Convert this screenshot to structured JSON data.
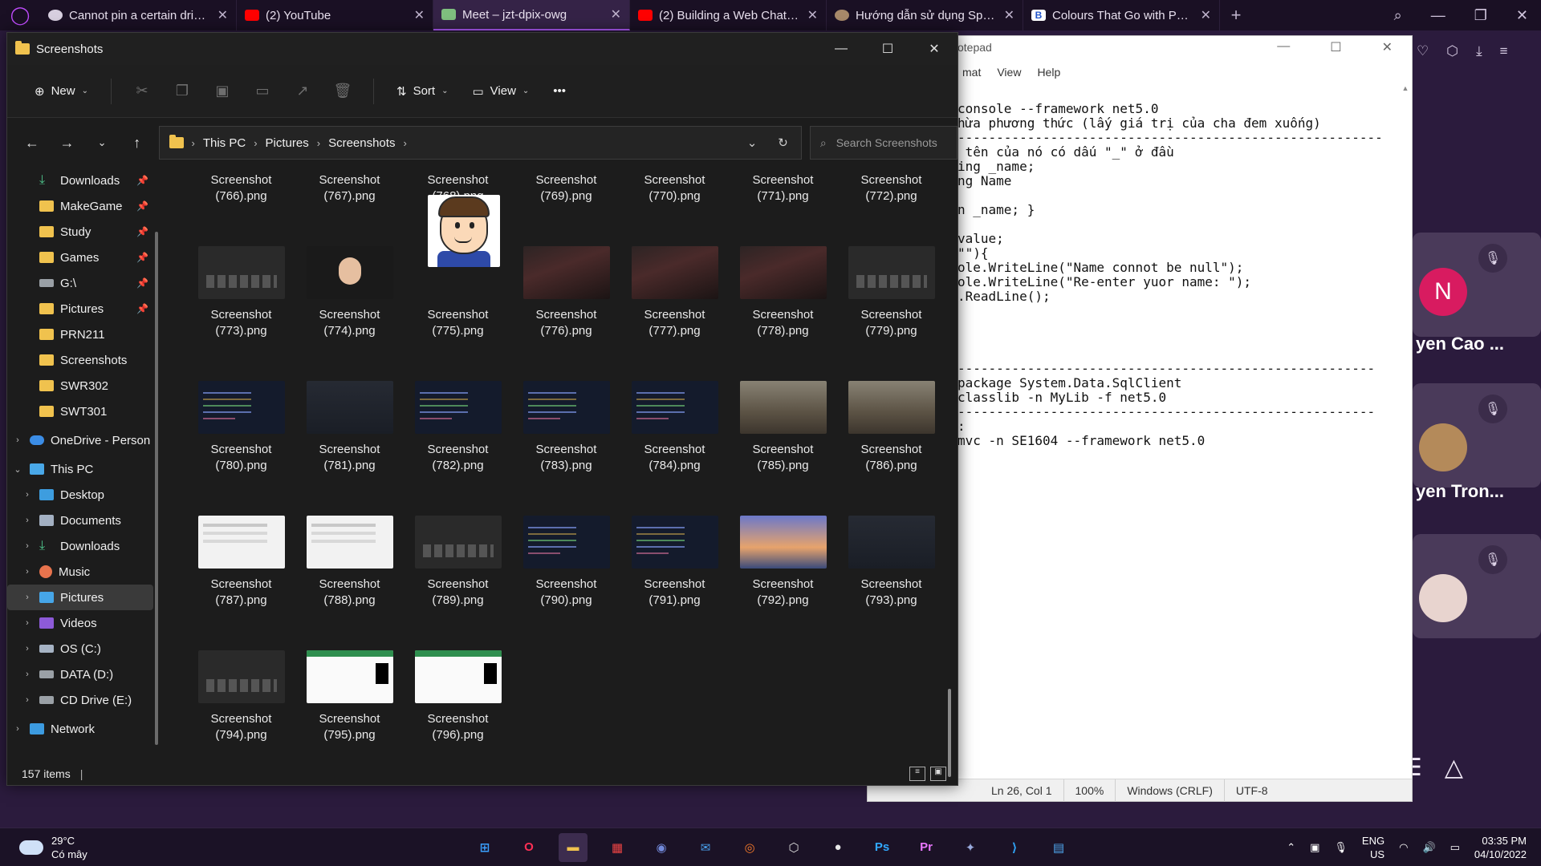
{
  "browser": {
    "tabs": [
      {
        "title": "Cannot pin a certain drive t",
        "fav": "gh",
        "active": false
      },
      {
        "title": "(2) YouTube",
        "fav": "yt",
        "active": false
      },
      {
        "title": "Meet – jzt-dpix-owg",
        "fav": "meet",
        "active": true
      },
      {
        "title": "(2) Building a Web ChatBot",
        "fav": "yt",
        "active": false
      },
      {
        "title": "Hướng dẫn sử dụng Spring",
        "fav": "spring",
        "active": false
      },
      {
        "title": "Colours That Go with Purpl",
        "fav": "blog",
        "active": false
      }
    ],
    "new_tab_glyph": "+",
    "close_glyph": "✕"
  },
  "meet": {
    "participants": [
      {
        "avatar_letter": "N",
        "avatar_color": "#d81b60",
        "name": "yen Cao ..."
      },
      {
        "avatar_letter": "",
        "avatar_color": "#b48a5a",
        "name": "yen Tron..."
      },
      {
        "avatar_letter": "",
        "avatar_color": "#e8d4cf",
        "name": ""
      }
    ]
  },
  "notepad": {
    "title": "otepad",
    "menu": [
      "mat",
      "View",
      "Help"
    ],
    "lines": [
      "console --framework net5.0",
      "hừa phương thức (lấy giá trị của cha đem xuống)",
      "-------------------------------------------------------",
      " tên của nó có dấu \"_\" ở đầu",
      "ing _name;",
      "ng Name",
      "",
      "n _name; }",
      "",
      "value;",
      "\"\"){",
      "ole.WriteLine(\"Name connot be null\");",
      "ole.WriteLine(\"Re-enter yuor name: \");",
      ".ReadLine();",
      "",
      "",
      "",
      "",
      "------------------------------------------------------",
      "package System.Data.SqlClient",
      "classlib -n MyLib -f net5.0",
      "------------------------------------------------------",
      ":",
      "mvc -n SE1604 --framework net5.0"
    ],
    "status": {
      "position": "Ln 26, Col 1",
      "zoom": "100%",
      "line_ending": "Windows (CRLF)",
      "encoding": "UTF-8"
    }
  },
  "explorer": {
    "title": "Screenshots",
    "toolbar": {
      "new_label": "New",
      "sort_label": "Sort",
      "view_label": "View",
      "more_label": "•••"
    },
    "breadcrumb": [
      "This PC",
      "Pictures",
      "Screenshots"
    ],
    "search_placeholder": "Search Screenshots",
    "sidebar": [
      {
        "label": "Downloads",
        "icon": "download",
        "pinned": true,
        "indent": 1,
        "expander": ""
      },
      {
        "label": "MakeGame",
        "icon": "folder",
        "pinned": true,
        "indent": 1,
        "expander": ""
      },
      {
        "label": "Study",
        "icon": "folder",
        "pinned": true,
        "indent": 1,
        "expander": ""
      },
      {
        "label": "Games",
        "icon": "folder",
        "pinned": true,
        "indent": 1,
        "expander": ""
      },
      {
        "label": "G:\\",
        "icon": "drive",
        "pinned": true,
        "indent": 1,
        "expander": ""
      },
      {
        "label": "Pictures",
        "icon": "folder",
        "pinned": true,
        "indent": 1,
        "expander": ""
      },
      {
        "label": "PRN211",
        "icon": "folder",
        "pinned": false,
        "indent": 1,
        "expander": ""
      },
      {
        "label": "Screenshots",
        "icon": "folder",
        "pinned": false,
        "indent": 1,
        "expander": ""
      },
      {
        "label": "SWR302",
        "icon": "folder",
        "pinned": false,
        "indent": 1,
        "expander": ""
      },
      {
        "label": "SWT301",
        "icon": "folder",
        "pinned": false,
        "indent": 1,
        "expander": ""
      },
      {
        "label": "OneDrive - Person",
        "icon": "cloud",
        "pinned": false,
        "indent": 0,
        "expander": "›"
      },
      {
        "label": "This PC",
        "icon": "pc",
        "pinned": false,
        "indent": 0,
        "expander": "⌄"
      },
      {
        "label": "Desktop",
        "icon": "desktop",
        "pinned": false,
        "indent": 1,
        "expander": "›"
      },
      {
        "label": "Documents",
        "icon": "docs",
        "pinned": false,
        "indent": 1,
        "expander": "›"
      },
      {
        "label": "Downloads",
        "icon": "download",
        "pinned": false,
        "indent": 1,
        "expander": "›"
      },
      {
        "label": "Music",
        "icon": "music",
        "pinned": false,
        "indent": 1,
        "expander": "›"
      },
      {
        "label": "Pictures",
        "icon": "pictures",
        "pinned": false,
        "indent": 1,
        "expander": "›",
        "selected": true
      },
      {
        "label": "Videos",
        "icon": "videos",
        "pinned": false,
        "indent": 1,
        "expander": "›"
      },
      {
        "label": "OS (C:)",
        "icon": "os",
        "pinned": false,
        "indent": 1,
        "expander": "›"
      },
      {
        "label": "DATA (D:)",
        "icon": "drive",
        "pinned": false,
        "indent": 1,
        "expander": "›"
      },
      {
        "label": "CD Drive (E:)",
        "icon": "drive",
        "pinned": false,
        "indent": 1,
        "expander": "›"
      },
      {
        "label": "Network",
        "icon": "net",
        "pinned": false,
        "indent": 0,
        "expander": "›"
      }
    ],
    "files": [
      {
        "line1": "Screenshot",
        "line2": "(766).png",
        "thumb": "dark"
      },
      {
        "line1": "Screenshot",
        "line2": "(767).png",
        "thumb": "dark"
      },
      {
        "line1": "Screenshot",
        "line2": "(768).png",
        "thumb": "white"
      },
      {
        "line1": "Screenshot",
        "line2": "(769).png",
        "thumb": "dark"
      },
      {
        "line1": "Screenshot",
        "line2": "(770).png",
        "thumb": "film"
      },
      {
        "line1": "Screenshot",
        "line2": "(771).png",
        "thumb": "dark"
      },
      {
        "line1": "Screenshot",
        "line2": "(772).png",
        "thumb": "white"
      },
      {
        "line1": "Screenshot",
        "line2": "(773).png",
        "thumb": "editor"
      },
      {
        "line1": "Screenshot",
        "line2": "(774).png",
        "thumb": "meetshot"
      },
      {
        "line1": "Screenshot",
        "line2": "(775).png",
        "thumb": "avatar"
      },
      {
        "line1": "Screenshot",
        "line2": "(776).png",
        "thumb": "film"
      },
      {
        "line1": "Screenshot",
        "line2": "(777).png",
        "thumb": "film"
      },
      {
        "line1": "Screenshot",
        "line2": "(778).png",
        "thumb": "film"
      },
      {
        "line1": "Screenshot",
        "line2": "(779).png",
        "thumb": "editor"
      },
      {
        "line1": "Screenshot",
        "line2": "(780).png",
        "thumb": "code"
      },
      {
        "line1": "Screenshot",
        "line2": "(781).png",
        "thumb": "dark"
      },
      {
        "line1": "Screenshot",
        "line2": "(782).png",
        "thumb": "code"
      },
      {
        "line1": "Screenshot",
        "line2": "(783).png",
        "thumb": "code"
      },
      {
        "line1": "Screenshot",
        "line2": "(784).png",
        "thumb": "code"
      },
      {
        "line1": "Screenshot",
        "line2": "(785).png",
        "thumb": "ruins"
      },
      {
        "line1": "Screenshot",
        "line2": "(786).png",
        "thumb": "ruins"
      },
      {
        "line1": "Screenshot",
        "line2": "(787).png",
        "thumb": "white"
      },
      {
        "line1": "Screenshot",
        "line2": "(788).png",
        "thumb": "white"
      },
      {
        "line1": "Screenshot",
        "line2": "(789).png",
        "thumb": "editor"
      },
      {
        "line1": "Screenshot",
        "line2": "(790).png",
        "thumb": "code"
      },
      {
        "line1": "Screenshot",
        "line2": "(791).png",
        "thumb": "code"
      },
      {
        "line1": "Screenshot",
        "line2": "(792).png",
        "thumb": "sky"
      },
      {
        "line1": "Screenshot",
        "line2": "(793).png",
        "thumb": "dark"
      },
      {
        "line1": "Screenshot",
        "line2": "(794).png",
        "thumb": "editor"
      },
      {
        "line1": "Screenshot",
        "line2": "(795).png",
        "thumb": "sheet"
      },
      {
        "line1": "Screenshot",
        "line2": "(796).png",
        "thumb": "sheet"
      }
    ],
    "status_text": "157 items"
  },
  "taskbar": {
    "weather_temp": "29°C",
    "weather_desc": "Có mây",
    "apps": [
      {
        "name": "windows-start-icon",
        "glyph": "⊞",
        "color": "#3aa0ff"
      },
      {
        "name": "opera-gx-icon",
        "glyph": "O",
        "color": "#ff2f55"
      },
      {
        "name": "file-explorer-icon",
        "glyph": "▬",
        "color": "#f0c24e",
        "active": true
      },
      {
        "name": "app-grid-icon",
        "glyph": "▦",
        "color": "#e44"
      },
      {
        "name": "discord-icon",
        "glyph": "◉",
        "color": "#7289da"
      },
      {
        "name": "mail-icon",
        "glyph": "✉",
        "color": "#4aa3f0"
      },
      {
        "name": "blender-icon",
        "glyph": "◎",
        "color": "#f5792a"
      },
      {
        "name": "unity-icon",
        "glyph": "⬡",
        "color": "#dddddd"
      },
      {
        "name": "github-icon",
        "glyph": "●",
        "color": "#e8e8e8"
      },
      {
        "name": "photoshop-icon",
        "glyph": "Ps",
        "color": "#31a8ff"
      },
      {
        "name": "premiere-icon",
        "glyph": "Pr",
        "color": "#ea77ff"
      },
      {
        "name": "wings-icon",
        "glyph": "✦",
        "color": "#9ad"
      },
      {
        "name": "vscode-icon",
        "glyph": "⟩",
        "color": "#2f9ff0"
      },
      {
        "name": "notepad-icon",
        "glyph": "▤",
        "color": "#4fa8f0"
      }
    ],
    "lang_top": "ENG",
    "lang_bottom": "US",
    "time": "03:35 PM",
    "date": "04/10/2022"
  }
}
